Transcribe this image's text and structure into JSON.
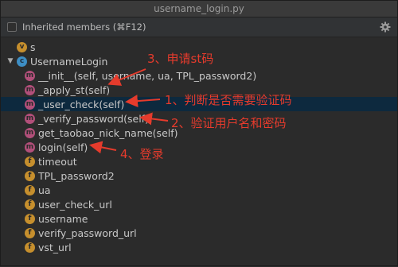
{
  "window": {
    "title": "username_login.py"
  },
  "toolbar": {
    "inherited_label": "Inherited members (⌘F12)",
    "checked": false
  },
  "colors": {
    "annotation": "#e53b2c",
    "method": "#b24f7a",
    "field": "#c68f2d",
    "class": "#3d8ec4",
    "selection": "#0d293e"
  },
  "tree": {
    "items": [
      {
        "kind": "v",
        "icon": "variable-icon",
        "badge": "v",
        "label": "s",
        "indent": 0
      },
      {
        "kind": "c",
        "icon": "class-icon",
        "badge": "c",
        "label": "UsernameLogin",
        "indent": 0,
        "expanded": true
      },
      {
        "kind": "m",
        "icon": "method-icon",
        "badge": "m",
        "label": "__init__(self, username, ua, TPL_password2)",
        "indent": 1
      },
      {
        "kind": "m",
        "icon": "method-icon",
        "badge": "m",
        "label": "_apply_st(self)",
        "indent": 1
      },
      {
        "kind": "m",
        "icon": "method-icon",
        "badge": "m",
        "label": "_user_check(self)",
        "indent": 1,
        "selected": true
      },
      {
        "kind": "m",
        "icon": "method-icon",
        "badge": "m",
        "label": "_verify_password(self)",
        "indent": 1
      },
      {
        "kind": "m",
        "icon": "method-icon",
        "badge": "m",
        "label": "get_taobao_nick_name(self)",
        "indent": 1
      },
      {
        "kind": "m",
        "icon": "method-icon",
        "badge": "m",
        "label": "login(self)",
        "indent": 1
      },
      {
        "kind": "f",
        "icon": "field-icon",
        "badge": "f",
        "label": "timeout",
        "indent": 1
      },
      {
        "kind": "f",
        "icon": "field-icon",
        "badge": "f",
        "label": "TPL_password2",
        "indent": 1
      },
      {
        "kind": "f",
        "icon": "field-icon",
        "badge": "f",
        "label": "ua",
        "indent": 1
      },
      {
        "kind": "f",
        "icon": "field-icon",
        "badge": "f",
        "label": "user_check_url",
        "indent": 1
      },
      {
        "kind": "f",
        "icon": "field-icon",
        "badge": "f",
        "label": "username",
        "indent": 1
      },
      {
        "kind": "f",
        "icon": "field-icon",
        "badge": "f",
        "label": "verify_password_url",
        "indent": 1
      },
      {
        "kind": "f",
        "icon": "field-icon",
        "badge": "f",
        "label": "vst_url",
        "indent": 1
      }
    ]
  },
  "annotations": {
    "note1": "1、判断是否需要验证码",
    "note2": "2、验证用户名和密码",
    "note3": "3、申请st码",
    "note4": "4、登录"
  }
}
